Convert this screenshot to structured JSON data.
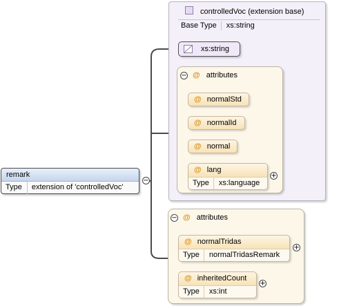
{
  "colors": {
    "line": "#4a4a4a",
    "extension_box": "#f4f0f9",
    "attribute_group": "#fdf7e9",
    "attribute_item": "#fbeed3",
    "element_header": "#c6d6ee",
    "attribute_icon": "#d9901a"
  },
  "icons": {
    "minus": "−",
    "plus": "+",
    "attribute": "@"
  },
  "element": {
    "name": "remark",
    "type_label": "Type",
    "type_value": "extension of 'controlledVoc'"
  },
  "extension": {
    "title": "controlledVoc (extension base)",
    "base_type_label": "Base Type",
    "base_type_value": "xs:string",
    "simple_type": "xs:string"
  },
  "base_attributes": {
    "title": "attributes",
    "items": [
      {
        "name": "normalStd"
      },
      {
        "name": "normalId"
      },
      {
        "name": "normal"
      },
      {
        "name": "lang",
        "type_label": "Type",
        "type_value": "xs:language"
      }
    ]
  },
  "own_attributes": {
    "title": "attributes",
    "items": [
      {
        "name": "normalTridas",
        "type_label": "Type",
        "type_value": "normalTridasRemark"
      },
      {
        "name": "inheritedCount",
        "type_label": "Type",
        "type_value": "xs:int"
      }
    ]
  }
}
